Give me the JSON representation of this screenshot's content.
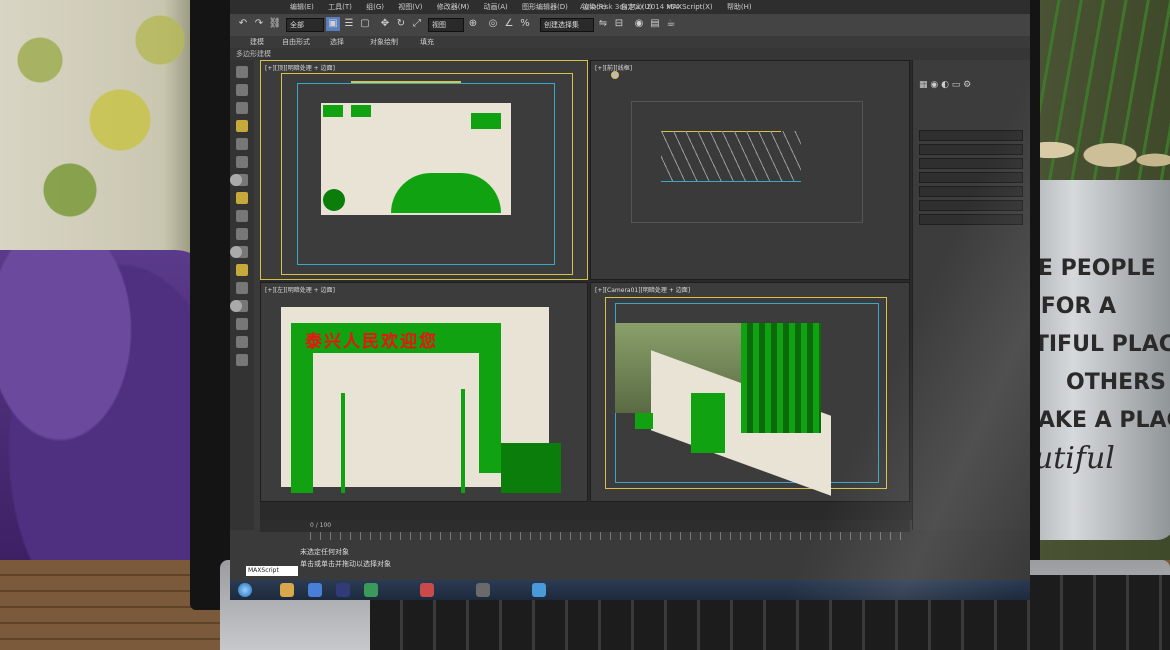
{
  "app": {
    "title": "Autodesk 3ds Max 2014 x64",
    "menu": [
      "编辑(E)",
      "工具(T)",
      "组(G)",
      "视图(V)",
      "修改器(M)",
      "动画(A)",
      "图形编辑器(D)",
      "渲染(R)",
      "自定义(U)",
      "MAXScript(X)",
      "帮助(H)"
    ]
  },
  "toolbar": {
    "selection_filter": "全部",
    "reference_coord": "视图",
    "named_selection": "创建选择集"
  },
  "ribbon": {
    "tabs": [
      "建模",
      "自由形式",
      "选择",
      "对象绘制",
      "填充"
    ],
    "subtitle": "多边形建模"
  },
  "viewports": {
    "top": {
      "label": "[+][顶][明暗处理 + 边面]"
    },
    "front": {
      "label": "[+][前][线框]"
    },
    "left": {
      "label": "[+][左][明暗处理 + 边面]"
    },
    "camera": {
      "label": "[+][Camera01][明暗处理 + 边面]"
    }
  },
  "scene": {
    "sign_text": "泰兴人民欢迎您"
  },
  "timeline": {
    "frame": "0 / 100"
  },
  "status": {
    "line1": "未选定任何对象",
    "line2": "单击或单击并拖动以选择对象",
    "maxscript": "MAXScript"
  },
  "pot": {
    "lines": [
      "ME PEOPLE",
      "K FOR A",
      "UTIFUL PLACE",
      "OTHERS",
      "MAKE A PLACE",
      "autiful"
    ]
  },
  "colors": {
    "scene_green": "#11a211",
    "frame_yellow": "#d8c24a",
    "frame_cyan": "#3aa7c9",
    "sign_red": "#ee1111",
    "ui_dark": "#3a3a3a"
  }
}
